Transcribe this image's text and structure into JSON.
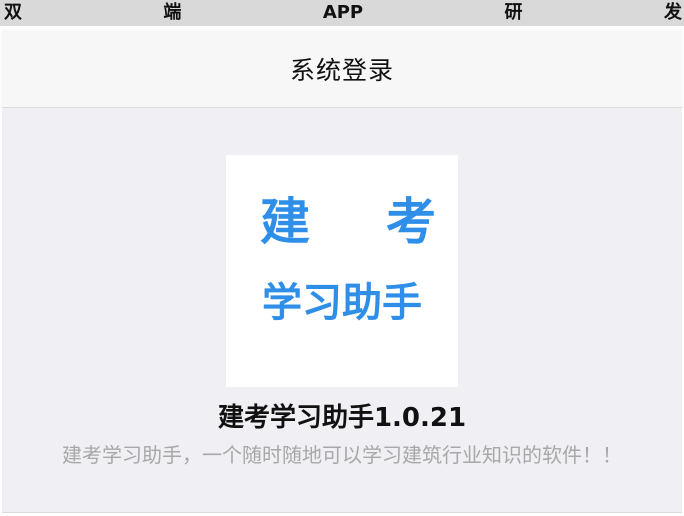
{
  "banner": {
    "chars": [
      "双",
      "端",
      "APP",
      "研",
      "发"
    ]
  },
  "navbar": {
    "title": "系统登录"
  },
  "logo": {
    "line1_left": "建",
    "line1_right": "考",
    "line2": "学习助手",
    "color": "#2f8fe8"
  },
  "app": {
    "name": "建考学习助手1.0.21",
    "description": "建考学习助手，一个随时随地可以学习建筑行业知识的软件！！"
  },
  "colors": {
    "background": "#efeff4",
    "navbar": "#f7f7f7",
    "banner": "#d9d9d9",
    "muted_text": "#a8a8a8"
  }
}
